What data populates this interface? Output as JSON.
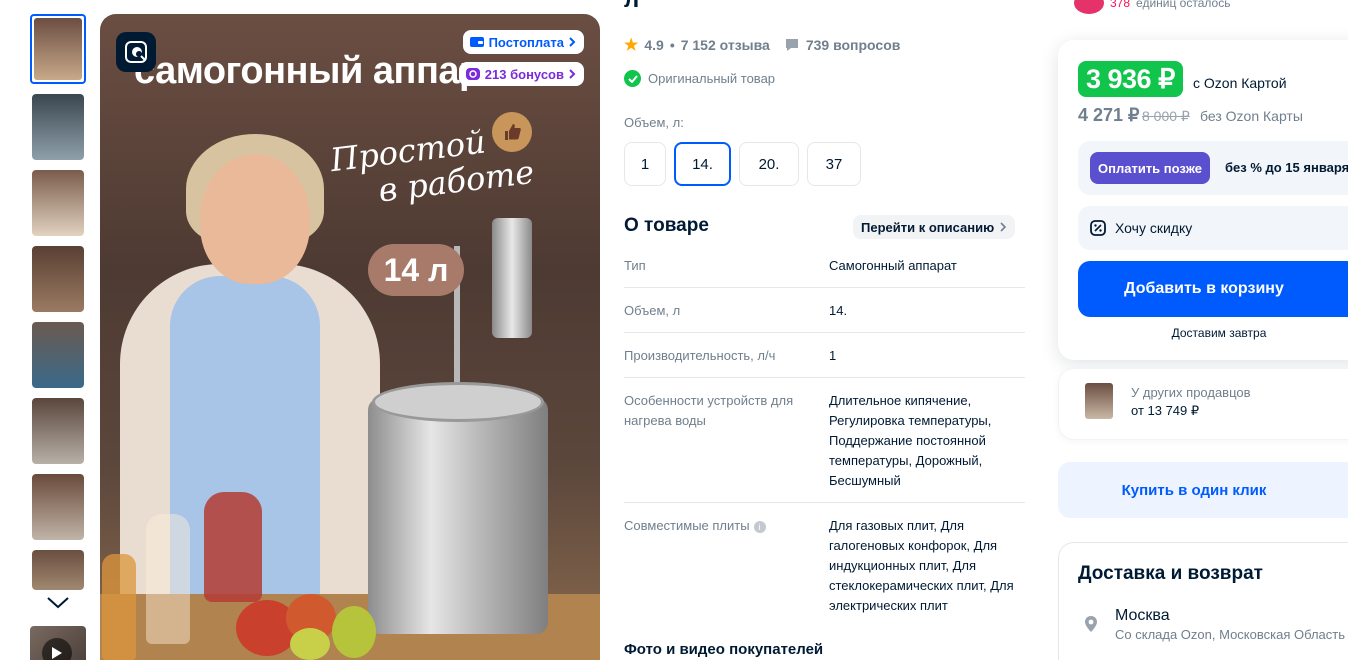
{
  "gallery": {
    "title_overlay": "самогонный аппарат",
    "slogan_line1": "Простой",
    "slogan_line2": "в работе",
    "volume_badge": "14 л",
    "postpay_label": "Постоплата",
    "bonus_label": "213 бонусов"
  },
  "product": {
    "title_fragment": "л",
    "rating": "4.9",
    "reviews": "7 152 отзыва",
    "questions": "739 вопросов",
    "original": "Оригинальный товар",
    "volume_label": "Объем, л:",
    "volume_options": [
      "1",
      "14.",
      "20.",
      "37"
    ],
    "selected_volume": "14."
  },
  "about": {
    "title": "О товаре",
    "goto_label": "Перейти к описанию",
    "specs": [
      {
        "key": "Тип",
        "value": "Самогонный аппарат"
      },
      {
        "key": "Объем, л",
        "value": "14."
      },
      {
        "key": "Производительность, л/ч",
        "value": "1"
      },
      {
        "key": "Особенности устройств для нагрева воды",
        "value": "Длительное кипячение, Регулировка температуры, Поддержание постоянной температуры, Дорожный, Бесшумный"
      },
      {
        "key": "Совместимые плиты",
        "value": "Для газовых плит, Для галогеновых конфорок, Для индукционных плит, Для стеклокерамических плит, Для электрических плит"
      }
    ],
    "photos_title": "Фото и видео покупателей"
  },
  "buy": {
    "units_left_num": "378",
    "units_left_text": "единиц осталось",
    "price_card": "3 936 ₽",
    "price_card_note": "с Ozon Картой",
    "price_regular": "4 271 ₽",
    "price_old": "8 000 ₽",
    "price_regular_note": "без Ozon Карты",
    "pay_later_btn": "Оплатить позже",
    "pay_later_note": "без % до 15 января",
    "want_discount": "Хочу скидку",
    "add_to_cart": "Добавить в корзину",
    "deliver_tomorrow": "Доставим завтра",
    "other_sellers_label": "У других продавцов",
    "other_sellers_price": "от 13 749 ₽",
    "buy_one_click": "Купить в один клик"
  },
  "delivery": {
    "title": "Доставка и возврат",
    "city": "Москва",
    "from": "Со склада Ozon, Московская Область"
  },
  "colors": {
    "accent": "#005bff",
    "price_green": "#10c44c",
    "pay_later": "#5a4fcf"
  }
}
